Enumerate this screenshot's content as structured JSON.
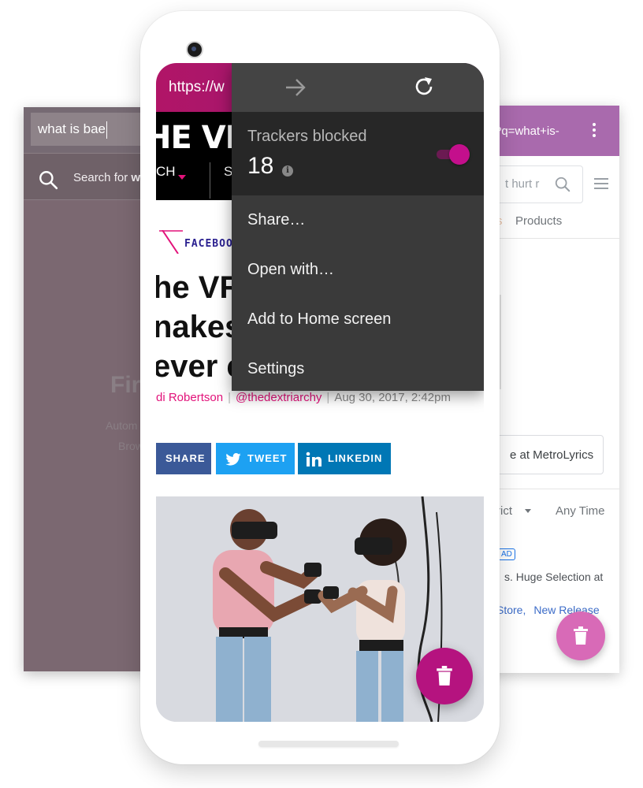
{
  "left_card": {
    "search_value": "what is bae",
    "suggestion_prefix": "Search for ",
    "suggestion_bold": "w",
    "faded_title": "Fire",
    "faded_line1": "Autom",
    "faded_line2": "Brow"
  },
  "right_card": {
    "url_fragment": "?q=what+is-",
    "search_fragment": "t hurt r",
    "tab_prev_fragment": "s",
    "tab_products": "Products",
    "metro_button": "e at MetroLyrics",
    "filter_district": "rict",
    "filter_time": "Any Time",
    "ad_badge": "AD",
    "ad_text": "s. Huge Selection at",
    "links": [
      "Store,",
      "New Release"
    ]
  },
  "browser": {
    "url_text": "https://w",
    "site_logo": "HE VE",
    "nav_item_1": "CH",
    "nav_item_2": "S"
  },
  "article": {
    "category": "FACEBOOK",
    "headline_lines": [
      "he VR",
      "nakes",
      "ever c"
    ],
    "byline_author": "di Robertson",
    "byline_handle": "@thedextriarchy",
    "byline_date": "Aug 30, 2017, 2:42pm",
    "share_buttons": {
      "share": "SHARE",
      "tweet": "TWEET",
      "linkedin": "LINKEDIN"
    }
  },
  "menu": {
    "trackers_label": "Trackers blocked",
    "trackers_count": "18",
    "trackers_toggle_on": true,
    "items": [
      "Share…",
      "Open with…",
      "Add to Home screen",
      "Settings"
    ]
  },
  "colors": {
    "accent_magenta": "#b5137f",
    "url_bar_gradient_start": "#b11567",
    "menu_background": "#3a3a3a",
    "left_card_background": "#7b6871",
    "right_card_urlbar": "#a96aad"
  }
}
